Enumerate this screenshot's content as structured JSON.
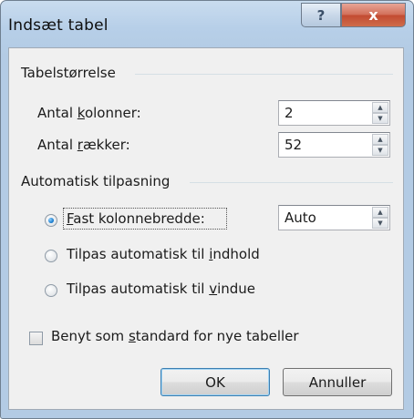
{
  "window": {
    "title": "Indsæt tabel",
    "help_glyph": "?",
    "close_glyph": "x"
  },
  "table_size": {
    "group_label": "Tabelstørrelse",
    "columns_label_pre": "Antal ",
    "columns_label_mnemonic": "k",
    "columns_label_post": "olonner:",
    "columns_value": "2",
    "rows_label_pre": "Antal ",
    "rows_label_mnemonic": "r",
    "rows_label_post": "ækker:",
    "rows_value": "52"
  },
  "autofit": {
    "group_label": "Automatisk tilpasning",
    "fixed_label_mnemonic": "F",
    "fixed_label_post": "ast kolonnebredde:",
    "fixed_value": "Auto",
    "content_label_pre": "Tilpas automatisk til ",
    "content_label_mnemonic": "i",
    "content_label_post": "ndhold",
    "window_label_pre": "Tilpas automatisk til ",
    "window_label_mnemonic": "v",
    "window_label_post": "indue",
    "selected": "fixed"
  },
  "default_checkbox": {
    "label_pre": "Benyt som ",
    "label_mnemonic": "s",
    "label_post": "tandard for nye tabeller",
    "checked": false
  },
  "buttons": {
    "ok": "OK",
    "cancel": "Annuller"
  },
  "icons": {
    "spin_up": "up-triangle",
    "spin_down": "down-triangle"
  },
  "colors": {
    "title_bar": "#b7cfe8",
    "close_button": "#c24b32",
    "client_bg": "#f0f0f0",
    "radio_selected": "#1d7fd0"
  }
}
